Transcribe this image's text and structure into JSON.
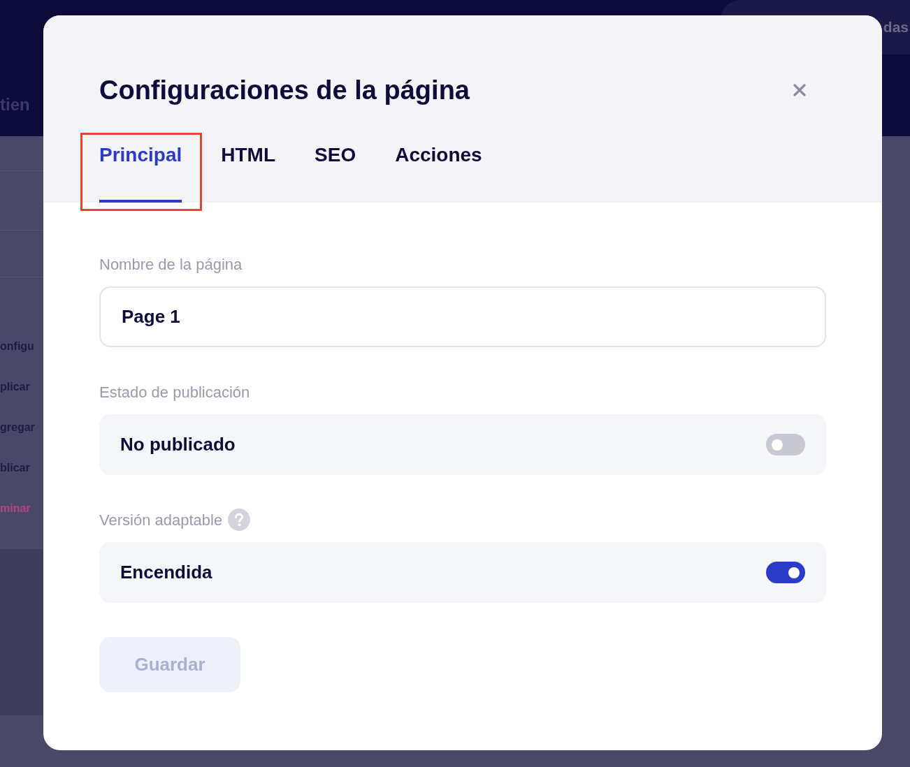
{
  "background": {
    "header_button": "das",
    "header_text": "tien",
    "menu_items": [
      {
        "label": "onfigu",
        "kind": "normal"
      },
      {
        "label": "plicar",
        "kind": "normal"
      },
      {
        "label": "gregar",
        "kind": "normal"
      },
      {
        "label": "blicar",
        "kind": "normal"
      },
      {
        "label": "minar",
        "kind": "danger"
      }
    ]
  },
  "dialog": {
    "title": "Configuraciones de la página",
    "tabs": [
      {
        "label": "Principal",
        "selected": true,
        "highlighted": true
      },
      {
        "label": "HTML",
        "selected": false,
        "highlighted": false
      },
      {
        "label": "SEO",
        "selected": false,
        "highlighted": false
      },
      {
        "label": "Acciones",
        "selected": false,
        "highlighted": false
      }
    ],
    "fields": [
      {
        "kind": "text",
        "label": "Nombre de la página",
        "help": false,
        "value": "Page 1"
      },
      {
        "kind": "toggle",
        "label": "Estado de publicación",
        "help": false,
        "value": "No publicado",
        "on": false
      },
      {
        "kind": "toggle",
        "label": "Versión adaptable",
        "help": true,
        "value": "Encendida",
        "on": true
      }
    ],
    "save_button": {
      "label": "Guardar",
      "disabled": true
    }
  }
}
